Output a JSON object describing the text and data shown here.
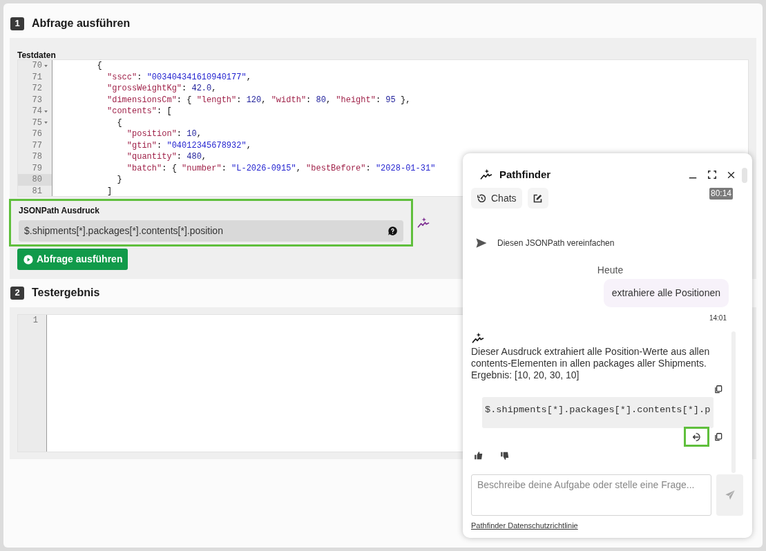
{
  "query_section": {
    "number": "1",
    "title": "Abfrage ausführen",
    "test_data_label": "Testdaten",
    "editor": {
      "lines": [
        {
          "number": "70",
          "foldable": true,
          "active": false,
          "tokens": [
            {
              "kind": "punct",
              "text": "        {"
            }
          ]
        },
        {
          "number": "71",
          "foldable": false,
          "active": false,
          "tokens": [
            {
              "kind": "key",
              "text": "          \"sscc\""
            },
            {
              "kind": "punct",
              "text": ": "
            },
            {
              "kind": "string",
              "text": "\"003404341610940177\""
            },
            {
              "kind": "punct",
              "text": ","
            }
          ]
        },
        {
          "number": "72",
          "foldable": false,
          "active": false,
          "tokens": [
            {
              "kind": "key",
              "text": "          \"grossWeightKg\""
            },
            {
              "kind": "punct",
              "text": ": "
            },
            {
              "kind": "number",
              "text": "42.0"
            },
            {
              "kind": "punct",
              "text": ","
            }
          ]
        },
        {
          "number": "73",
          "foldable": false,
          "active": false,
          "tokens": [
            {
              "kind": "key",
              "text": "          \"dimensionsCm\""
            },
            {
              "kind": "punct",
              "text": ": { "
            },
            {
              "kind": "key",
              "text": "\"length\""
            },
            {
              "kind": "punct",
              "text": ": "
            },
            {
              "kind": "number",
              "text": "120"
            },
            {
              "kind": "punct",
              "text": ", "
            },
            {
              "kind": "key",
              "text": "\"width\""
            },
            {
              "kind": "punct",
              "text": ": "
            },
            {
              "kind": "number",
              "text": "80"
            },
            {
              "kind": "punct",
              "text": ", "
            },
            {
              "kind": "key",
              "text": "\"height\""
            },
            {
              "kind": "punct",
              "text": ": "
            },
            {
              "kind": "number",
              "text": "95"
            },
            {
              "kind": "punct",
              "text": " },"
            }
          ]
        },
        {
          "number": "74",
          "foldable": true,
          "active": false,
          "tokens": [
            {
              "kind": "key",
              "text": "          \"contents\""
            },
            {
              "kind": "punct",
              "text": ": ["
            }
          ]
        },
        {
          "number": "75",
          "foldable": true,
          "active": false,
          "tokens": [
            {
              "kind": "punct",
              "text": "            {"
            }
          ]
        },
        {
          "number": "76",
          "foldable": false,
          "active": false,
          "tokens": [
            {
              "kind": "key",
              "text": "              \"position\""
            },
            {
              "kind": "punct",
              "text": ": "
            },
            {
              "kind": "number",
              "text": "10"
            },
            {
              "kind": "punct",
              "text": ","
            }
          ]
        },
        {
          "number": "77",
          "foldable": false,
          "active": false,
          "tokens": [
            {
              "kind": "key",
              "text": "              \"gtin\""
            },
            {
              "kind": "punct",
              "text": ": "
            },
            {
              "kind": "string",
              "text": "\"04012345678932\""
            },
            {
              "kind": "punct",
              "text": ","
            }
          ]
        },
        {
          "number": "78",
          "foldable": false,
          "active": false,
          "tokens": [
            {
              "kind": "key",
              "text": "              \"quantity\""
            },
            {
              "kind": "punct",
              "text": ": "
            },
            {
              "kind": "number",
              "text": "480"
            },
            {
              "kind": "punct",
              "text": ","
            }
          ]
        },
        {
          "number": "79",
          "foldable": false,
          "active": false,
          "tokens": [
            {
              "kind": "key",
              "text": "              \"batch\""
            },
            {
              "kind": "punct",
              "text": ": { "
            },
            {
              "kind": "key",
              "text": "\"number\""
            },
            {
              "kind": "punct",
              "text": ": "
            },
            {
              "kind": "string",
              "text": "\"L-2026-0915\""
            },
            {
              "kind": "punct",
              "text": ", "
            },
            {
              "kind": "key",
              "text": "\"bestBefore\""
            },
            {
              "kind": "punct",
              "text": ": "
            },
            {
              "kind": "string",
              "text": "\"2028-01-31\""
            }
          ]
        },
        {
          "number": "80",
          "foldable": false,
          "active": true,
          "tokens": [
            {
              "kind": "punct",
              "text": "            }"
            }
          ]
        },
        {
          "number": "81",
          "foldable": false,
          "active": false,
          "tokens": [
            {
              "kind": "punct",
              "text": "          ]"
            }
          ]
        }
      ]
    },
    "jsonpath": {
      "label": "JSONPath Ausdruck",
      "value": "$.shipments[*].packages[*].contents[*].position",
      "highlighted": true
    },
    "run_button": "Abfrage ausführen"
  },
  "result_section": {
    "number": "2",
    "title": "Testergebnis",
    "editor": {
      "lines": [
        {
          "number": "1"
        }
      ]
    }
  },
  "chat": {
    "title": "Pathfinder",
    "cursor_badge": "80:14",
    "chats_button": "Chats",
    "suggestion": "Diesen JSONPath vereinfachen",
    "date": "Heute",
    "messages": [
      {
        "kind": "user",
        "text": "extrahiere alle Positionen",
        "time": "14:01"
      },
      {
        "kind": "assistant",
        "text": "Dieser Ausdruck extrahiert alle Position-Werte aus allen contents-Elementen in allen packages aller Shipments. Ergebnis: [10, 20, 30, 10]",
        "code": "$.shipments[*].packages[*].contents[*].p",
        "insert_highlighted": true
      }
    ],
    "input_placeholder": "Beschreibe deine Aufgabe oder stelle eine Frage...",
    "privacy_link": "Pathfinder Datenschutzrichtlinie"
  }
}
